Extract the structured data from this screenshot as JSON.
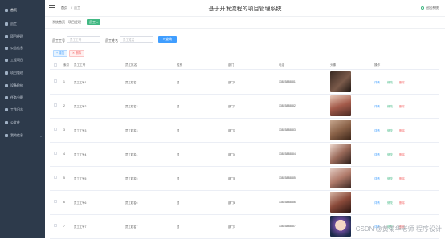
{
  "sidebar": {
    "items": [
      {
        "label": "首页",
        "icon": "home-icon"
      },
      {
        "label": "员工",
        "icon": "user-icon"
      },
      {
        "label": "项目经理",
        "icon": "manager-icon"
      },
      {
        "label": "公告信息",
        "icon": "notice-icon"
      },
      {
        "label": "工程项目",
        "icon": "project-icon"
      },
      {
        "label": "项目管理",
        "icon": "manage-icon"
      },
      {
        "label": "设备检修",
        "icon": "device-icon"
      },
      {
        "label": "任务分配",
        "icon": "task-icon"
      },
      {
        "label": "工作日志",
        "icon": "log-icon"
      },
      {
        "label": "公文件",
        "icon": "file-icon"
      },
      {
        "label": "我的信息",
        "icon": "profile-icon"
      }
    ]
  },
  "topbar": {
    "crumb_home": "首页",
    "crumb_current": "员工",
    "title": "基于开发流程的项目管理系统",
    "logout": "退出系统"
  },
  "tags": {
    "prefix": "系统首页",
    "middle": "项目经理",
    "active": "员工"
  },
  "search": {
    "label1": "员工工号",
    "placeholder1": "员工工号",
    "label2": "员工姓名",
    "placeholder2": "员工姓名",
    "button": "查询"
  },
  "actions": {
    "add": "增加",
    "delete": "删除"
  },
  "table": {
    "headers": [
      "索引",
      "员工工号",
      "员工姓名",
      "性别",
      "部门",
      "电话",
      "头像",
      "操作"
    ],
    "rows": [
      {
        "index": "1",
        "no": "员工工号1",
        "name": "员工姓名1",
        "gender": "男",
        "dept": "部门1",
        "phone": "13823888881"
      },
      {
        "index": "2",
        "no": "员工工号2",
        "name": "员工姓名2",
        "gender": "男",
        "dept": "部门2",
        "phone": "13823888882"
      },
      {
        "index": "3",
        "no": "员工工号3",
        "name": "员工姓名3",
        "gender": "男",
        "dept": "部门3",
        "phone": "13823888883"
      },
      {
        "index": "4",
        "no": "员工工号4",
        "name": "员工姓名4",
        "gender": "男",
        "dept": "部门4",
        "phone": "13823888884"
      },
      {
        "index": "5",
        "no": "员工工号5",
        "name": "员工姓名5",
        "gender": "男",
        "dept": "部门5",
        "phone": "13823888885"
      },
      {
        "index": "6",
        "no": "员工工号6",
        "name": "员工姓名6",
        "gender": "男",
        "dept": "部门6",
        "phone": "13823888886"
      },
      {
        "index": "7",
        "no": "员工工号7",
        "name": "员工姓名7",
        "gender": "男",
        "dept": "部门7",
        "phone": "13823888887"
      }
    ],
    "row_actions": {
      "detail": "详情",
      "edit": "修改",
      "delete": "删除"
    }
  },
  "watermark": "CSDN @黄菊华老师 程序设计"
}
